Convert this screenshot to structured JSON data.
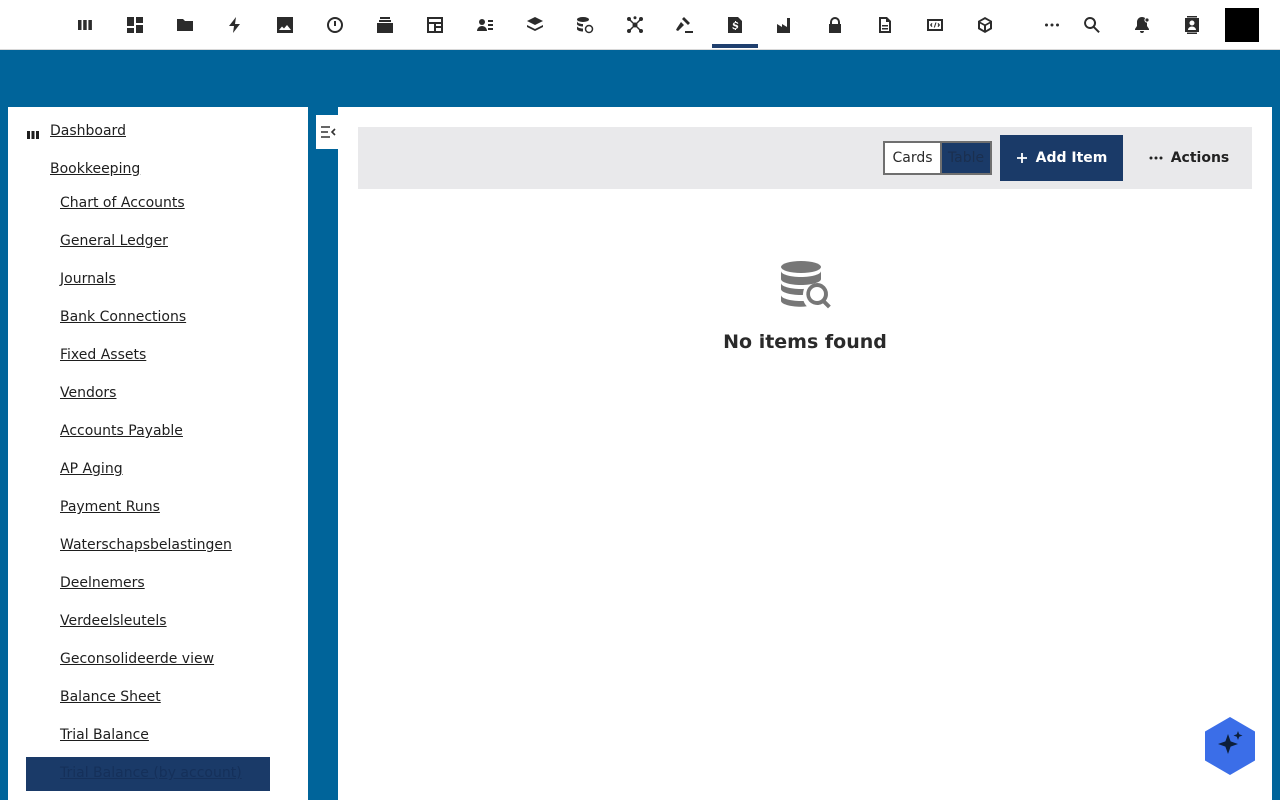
{
  "topbar": {
    "apps": [
      {
        "name": "kanban-icon",
        "active": false
      },
      {
        "name": "grid-icon",
        "active": false
      },
      {
        "name": "folder-icon",
        "active": false
      },
      {
        "name": "bolt-icon",
        "active": false
      },
      {
        "name": "image-icon",
        "active": false
      },
      {
        "name": "clock-icon",
        "active": false
      },
      {
        "name": "stack-icon",
        "active": false
      },
      {
        "name": "calculator-icon",
        "active": false
      },
      {
        "name": "contacts-icon",
        "active": false
      },
      {
        "name": "layers-icon",
        "active": false
      },
      {
        "name": "database-sync-icon",
        "active": false
      },
      {
        "name": "network-icon",
        "active": false
      },
      {
        "name": "gavel-icon",
        "active": false
      },
      {
        "name": "invoice-dollar-icon",
        "active": true
      },
      {
        "name": "factory-icon",
        "active": false
      },
      {
        "name": "lock-icon",
        "active": false
      },
      {
        "name": "document-icon",
        "active": false
      },
      {
        "name": "code-icon",
        "active": false
      },
      {
        "name": "cube-icon",
        "active": false
      }
    ],
    "right": [
      "more-icon",
      "search-icon",
      "notifications-icon",
      "account-icon"
    ]
  },
  "sidebar": {
    "dashboard": "Dashboard",
    "section": "Bookkeeping",
    "items": [
      "Chart of Accounts",
      "General Ledger",
      "Journals",
      "Bank Connections",
      "Fixed Assets",
      "Vendors",
      "Accounts Payable",
      "AP Aging",
      "Payment Runs",
      "Waterschapsbelastingen",
      "Deelnemers",
      "Verdeelsleutels",
      "Geconsolideerde view",
      "Balance Sheet",
      "Trial Balance"
    ],
    "selected": "Trial Balance (by account)"
  },
  "toolbar": {
    "view_cards": "Cards",
    "view_table": "Table",
    "selected_view": "Table",
    "add_label": "Add Item",
    "actions_label": "Actions"
  },
  "empty_state": {
    "icon": "database-search-icon",
    "text": "No items found"
  },
  "colors": {
    "brand": "#00649a",
    "accent": "#1a3a68",
    "ai_button": "#3b6ee8"
  }
}
